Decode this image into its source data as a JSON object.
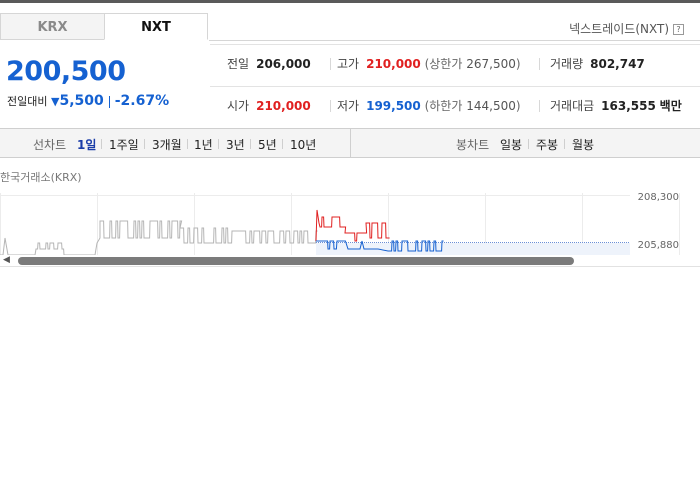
{
  "tabs": {
    "krx": "KRX",
    "nxt": "NXT"
  },
  "venue": {
    "label": "넥스트레이드(NXT)",
    "help_icon": "?"
  },
  "quote": {
    "price": "200,500",
    "change_label": "전일대비",
    "change_dir_icon": "down-triangle-icon",
    "change_value": "5,500",
    "change_pct": "-2.67%"
  },
  "stats": {
    "prev_close_label": "전일",
    "prev_close": "206,000",
    "high_label": "고가",
    "high": "210,000",
    "upper_limit_label": "상한가",
    "upper_limit": "267,500",
    "volume_label": "거래량",
    "volume": "802,747",
    "open_label": "시가",
    "open": "210,000",
    "low_label": "저가",
    "low": "199,500",
    "lower_limit_label": "하한가",
    "lower_limit": "144,500",
    "value_label": "거래대금",
    "value": "163,555",
    "value_unit": "백만"
  },
  "line_chart_bar": {
    "label": "선차트",
    "periods": [
      "1일",
      "1주일",
      "3개월",
      "1년",
      "3년",
      "5년",
      "10년"
    ],
    "active": "1일"
  },
  "candle_chart_bar": {
    "label": "봉차트",
    "periods": [
      "일봉",
      "주봉",
      "월봉"
    ]
  },
  "chart": {
    "title": "한국거래소(KRX)",
    "y_ticks": [
      "208,300",
      "205,880"
    ],
    "colors": {
      "gray": "#b5b5b5",
      "red": "#e02020",
      "blue": "#1561d1",
      "baseline": "#6b8fd6"
    }
  },
  "scrollbar": {
    "left_arrow_icon": "◀"
  }
}
